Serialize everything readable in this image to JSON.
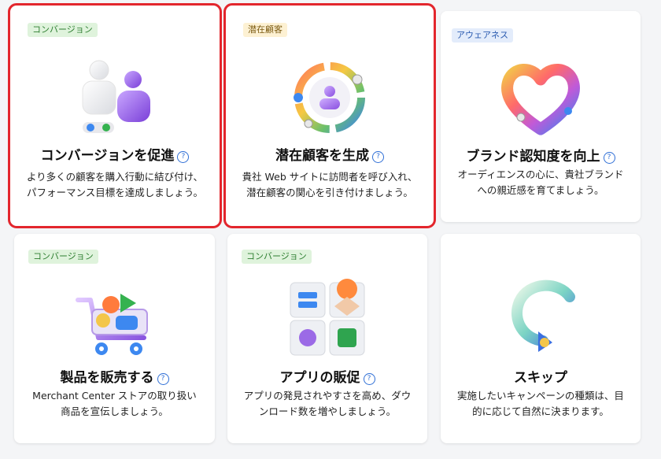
{
  "help_glyph": "?",
  "cards": [
    {
      "badge": "コンバージョン",
      "title": "コンバージョンを促進",
      "desc": "より多くの顧客を購入行動に結び付け、パフォーマンス目標を達成しましょう。"
    },
    {
      "badge": "潜在顧客",
      "title": "潜在顧客を生成",
      "desc": "貴社 Web サイトに訪問者を呼び入れ、潜在顧客の関心を引き付けましょう。"
    },
    {
      "badge": "アウェアネス",
      "title": "ブランド認知度を向上",
      "desc": "オーディエンスの心に、貴社ブランドへの親近感を育てましょう。"
    },
    {
      "badge": "コンバージョン",
      "title": "製品を販売する",
      "desc": "Merchant Center ストアの取り扱い商品を宣伝しましょう。"
    },
    {
      "badge": "コンバージョン",
      "title": "アプリの販促",
      "desc": "アプリの発見されやすさを高め、ダウンロード数を増やしましょう。"
    },
    {
      "title": "スキップ",
      "desc": "実施したいキャンペーンの種類は、目的に応じて自然に決まります。"
    }
  ]
}
